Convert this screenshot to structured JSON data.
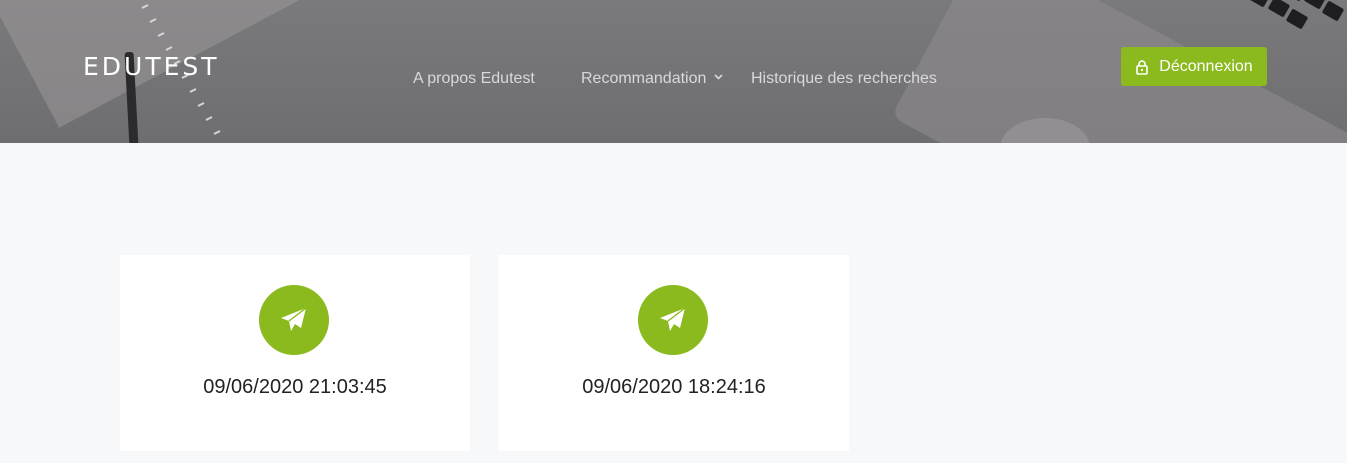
{
  "header": {
    "brand": "EDUTEST",
    "nav": [
      {
        "label": "A propos Edutest"
      },
      {
        "label": "Recommandation",
        "has_dropdown": true
      },
      {
        "label": "Historique des recherches"
      }
    ],
    "logout_label": "Déconnexion",
    "logout_icon": "lock-icon"
  },
  "cards": [
    {
      "icon": "paper-plane-icon",
      "datetime": "09/06/2020 21:03:45"
    },
    {
      "icon": "paper-plane-icon",
      "datetime": "09/06/2020 18:24:16"
    }
  ],
  "colors": {
    "accent": "#8aba1d",
    "header_bg": "#747477",
    "page_bg": "#f7f8fa",
    "card_bg": "#ffffff"
  }
}
